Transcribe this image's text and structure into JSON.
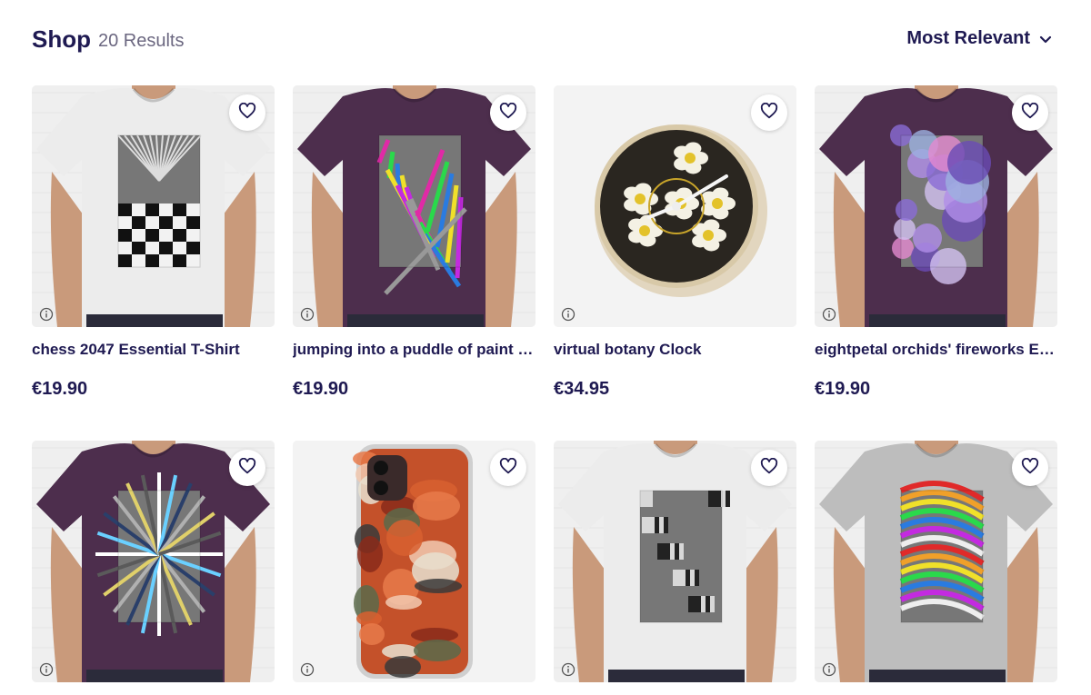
{
  "header": {
    "title": "Shop",
    "result_count": "20 Results",
    "sort_label": "Most Relevant",
    "sort_icon": "chevron-down-icon"
  },
  "products": [
    {
      "title": "chess 2047 Essential T-Shirt",
      "price": "€19.90",
      "kind": "tshirt",
      "shirt_color": "#ececec",
      "art": "chess"
    },
    {
      "title": "jumping into a puddle of paint Essential T-Shirt",
      "price": "€19.90",
      "kind": "tshirt",
      "shirt_color": "#4d2e4d",
      "art": "neon"
    },
    {
      "title": "virtual botany Clock",
      "price": "€34.95",
      "kind": "clock",
      "art": "flowers"
    },
    {
      "title": "eightpetal orchids' fireworks Essential T-Shirt",
      "price": "€19.90",
      "kind": "tshirt",
      "shirt_color": "#4d2e4d",
      "art": "purple"
    },
    {
      "title": "",
      "price": "",
      "kind": "tshirt",
      "shirt_color": "#4d2e4d",
      "art": "burst"
    },
    {
      "title": "",
      "price": "",
      "kind": "phone",
      "art": "paint"
    },
    {
      "title": "",
      "price": "",
      "kind": "tshirt",
      "shirt_color": "#ececec",
      "art": "gray"
    },
    {
      "title": "",
      "price": "",
      "kind": "tshirt",
      "shirt_color": "#bdbdbd",
      "art": "rainbow"
    }
  ],
  "icons": {
    "favorite": "heart-icon",
    "info": "info-icon"
  },
  "colors": {
    "text": "#1f1a52",
    "muted": "#6b6780",
    "wall": "#efefef"
  }
}
